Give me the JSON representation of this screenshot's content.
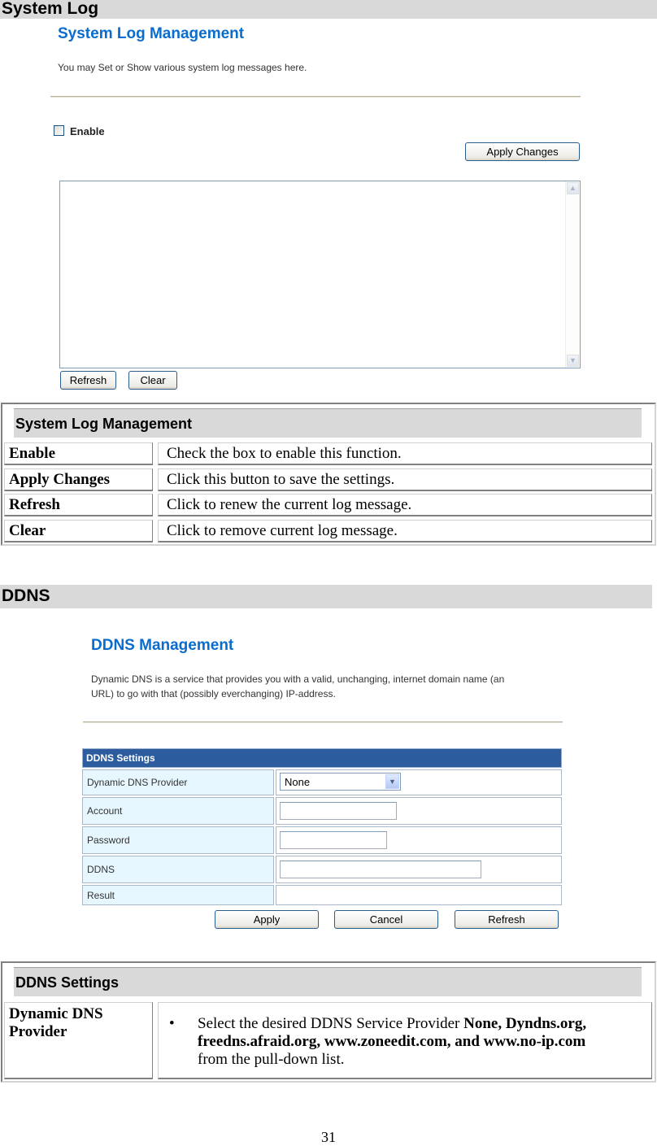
{
  "system_log_section": {
    "title": "System Log",
    "ui": {
      "title": "System Log Management",
      "description": "You may Set or Show various system log messages here.",
      "enable_label": "Enable",
      "enable_checked": false,
      "apply_button": "Apply Changes",
      "log_text": "",
      "refresh_button": "Refresh",
      "clear_button": "Clear"
    },
    "table": {
      "header": "System Log Management",
      "rows": [
        {
          "key": "Enable",
          "value": "Check the box to enable this function."
        },
        {
          "key": "Apply Changes",
          "value": "Click this button to save the settings."
        },
        {
          "key": "Refresh",
          "value": "Click to renew the current log message."
        },
        {
          "key": "Clear",
          "value": "Click to remove current log message."
        }
      ]
    }
  },
  "ddns_section": {
    "title": "DDNS",
    "ui": {
      "title": "DDNS Management",
      "description_line1": "Dynamic DNS is a service that provides you with a valid, unchanging, internet domain name (an",
      "description_line2": "URL) to go with that (possibly everchanging) IP-address.",
      "settings_header": "DDNS Settings",
      "fields": {
        "provider_label": "Dynamic DNS Provider",
        "provider_value": "None",
        "account_label": "Account",
        "account_value": "",
        "password_label": "Password",
        "password_value": "",
        "ddns_label": "DDNS",
        "ddns_value": "",
        "result_label": "Result",
        "result_value": ""
      },
      "apply_button": "Apply",
      "cancel_button": "Cancel",
      "refresh_button": "Refresh"
    },
    "table": {
      "header": "DDNS Settings",
      "rows": [
        {
          "key_line1": "Dynamic DNS",
          "key_line2": "Provider",
          "bullet": "•",
          "value_prefix": "Select the desired DDNS Service Provider ",
          "value_bold1": "None, Dyndns.org,",
          "value_bold2": "freedns.afraid.org, www.zoneedit.com, and www.no-ip.com",
          "value_suffix": "from the pull-down list."
        }
      ]
    }
  },
  "page_number": "31",
  "colors": {
    "section_bar": "#d9d9d9",
    "ui_title_blue": "#0a6ccc",
    "ddns_header_blue": "#2d5c9e",
    "ddns_label_bg": "#e6f7ff"
  }
}
